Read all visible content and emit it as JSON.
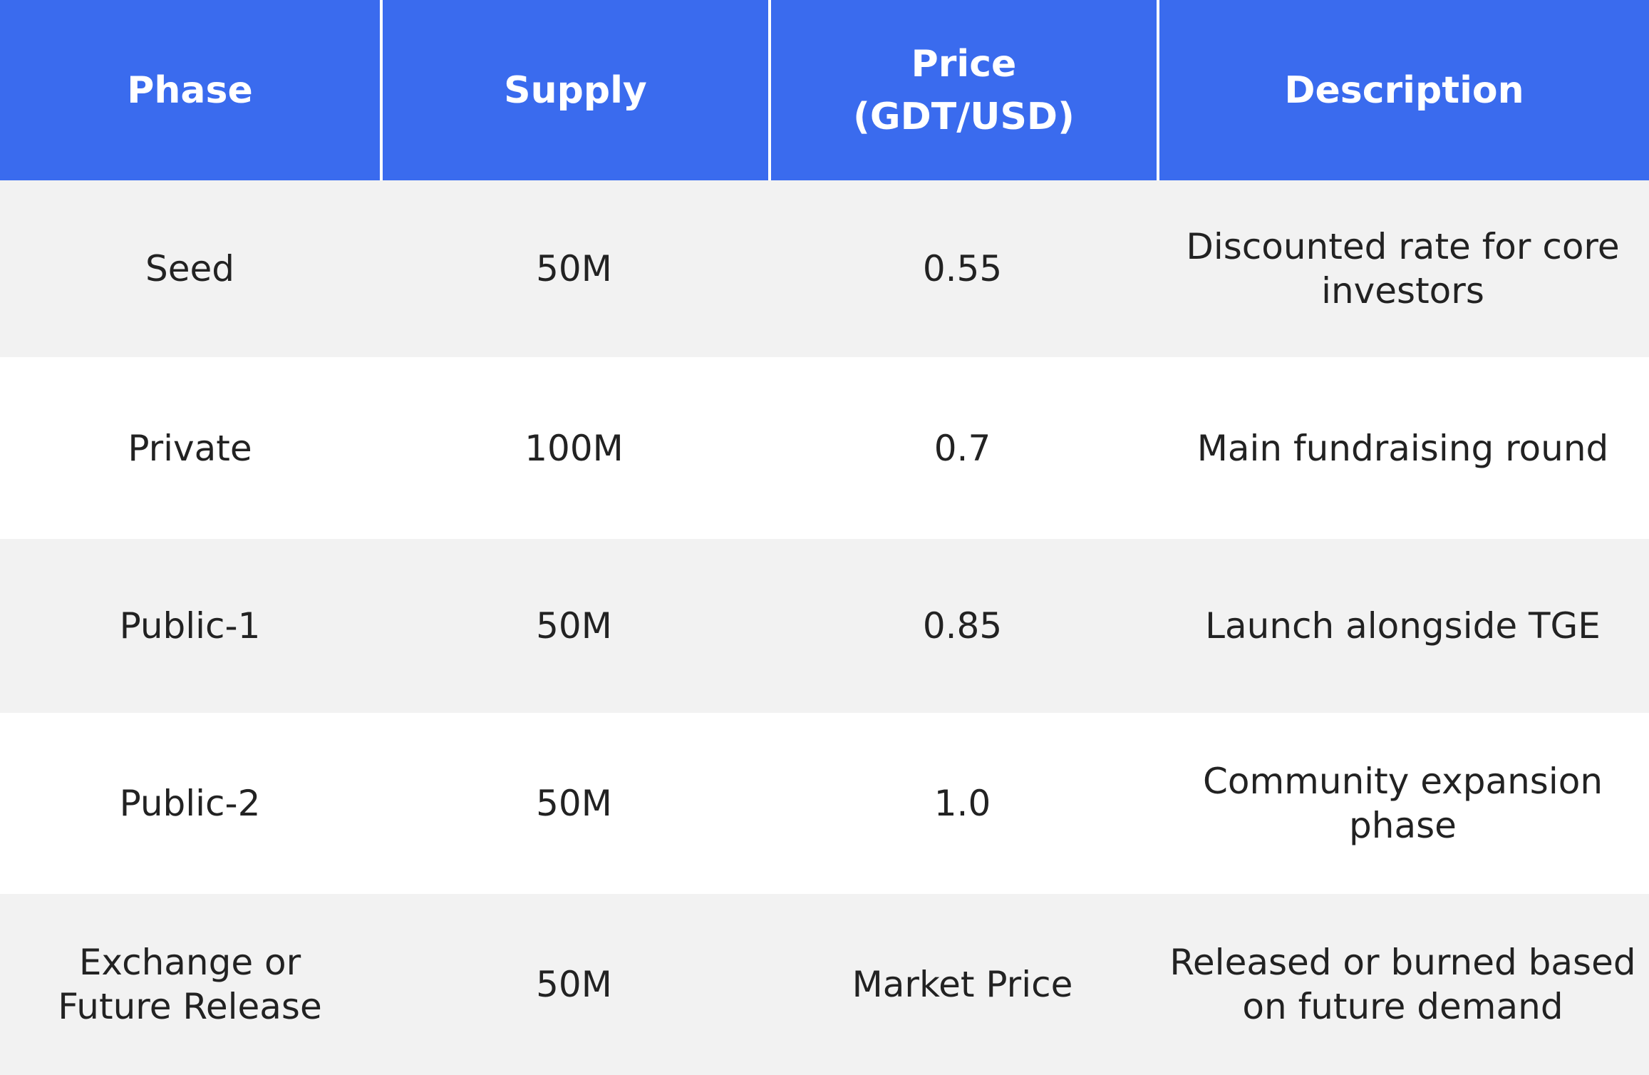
{
  "header": {
    "phase": "Phase",
    "supply": "Supply",
    "price_line1": "Price",
    "price_line2": "(GDT/USD)",
    "description": "Description"
  },
  "rows": [
    {
      "phase": "Seed",
      "supply": "50M",
      "price": "0.55",
      "description": "Discounted rate for core investors"
    },
    {
      "phase": "Private",
      "supply": "100M",
      "price": "0.7",
      "description": "Main fundraising round"
    },
    {
      "phase": "Public-1",
      "supply": "50M",
      "price": "0.85",
      "description": "Launch alongside TGE"
    },
    {
      "phase": "Public-2",
      "supply": "50M",
      "price": "1.0",
      "description": "Community expansion phase"
    },
    {
      "phase": "Exchange or Future Release",
      "supply": "50M",
      "price": "Market Price",
      "description": "Released or burned based on future demand"
    }
  ],
  "colors": {
    "header_bg": "#3a6bee",
    "row_shaded_bg": "#f2f2f2",
    "row_plain_bg": "#ffffff"
  }
}
